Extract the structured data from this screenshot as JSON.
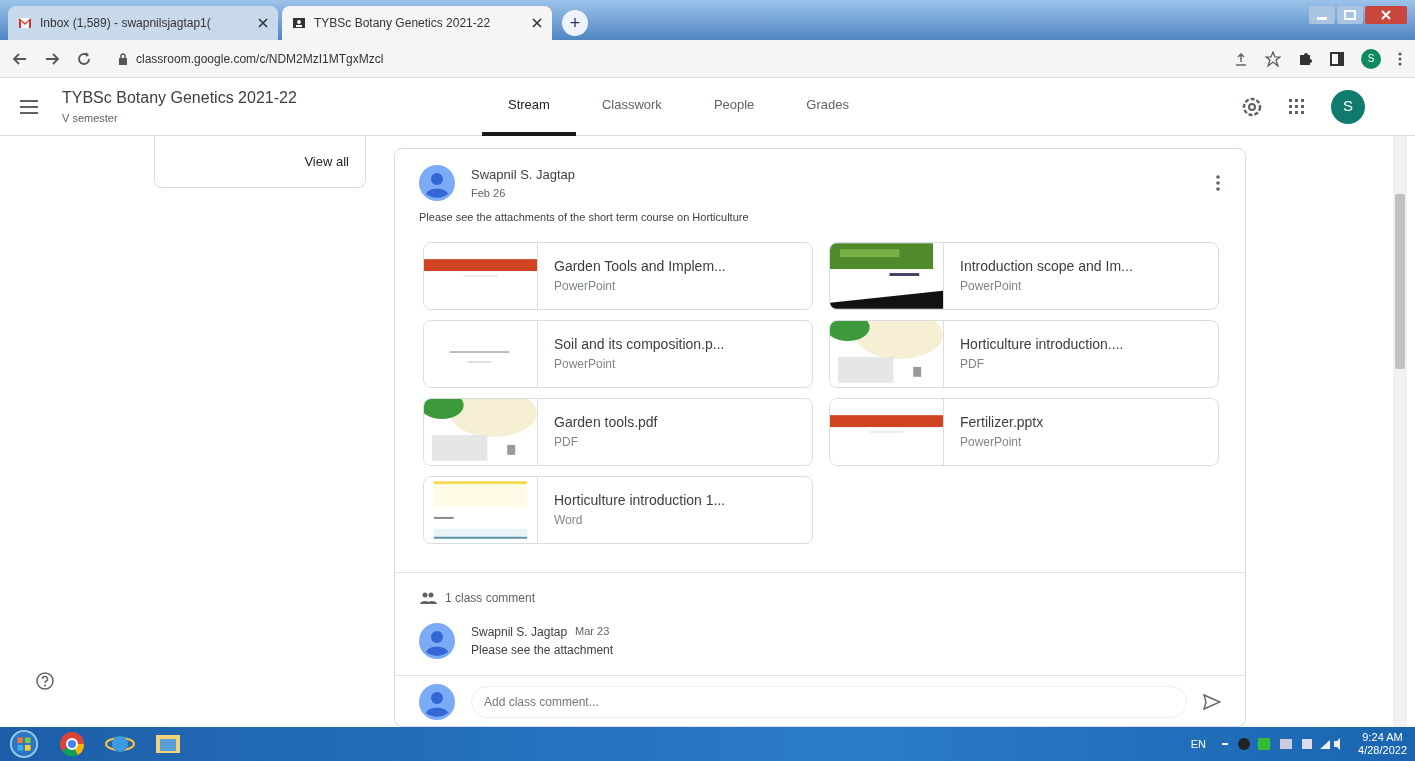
{
  "browser": {
    "tabs": [
      {
        "label": "Inbox (1,589) - swapnilsjagtap1(",
        "selected": false,
        "kind": "mail"
      },
      {
        "label": "TYBSc Botany Genetics 2021-22",
        "selected": true,
        "kind": "classroom"
      }
    ],
    "new_tab": "+",
    "url": "classroom.google.com/c/NDM2MzI1MTgxMzcl",
    "profile": "S"
  },
  "header": {
    "title": "TYBSc Botany Genetics 2021-22",
    "subtitle": "V semester",
    "nav": [
      {
        "label": "Stream",
        "selected": true
      },
      {
        "label": "Classwork",
        "selected": false
      },
      {
        "label": "People",
        "selected": false
      },
      {
        "label": "Grades",
        "selected": false
      }
    ],
    "avatar": "S"
  },
  "sidebar": {
    "link": "View all"
  },
  "post": {
    "author": "Swapnil S. Jagtap",
    "date": "Feb 26",
    "text": "Please see the attachments of the short term course on Horticulture",
    "attachments": [
      {
        "title": "Garden Tools and Implem...",
        "type": "PowerPoint",
        "kind": "banner"
      },
      {
        "title": "Introduction scope and Im...",
        "type": "PowerPoint",
        "kind": "photo"
      },
      {
        "title": "Soil and its composition.p...",
        "type": "PowerPoint",
        "kind": "blank"
      },
      {
        "title": "Horticulture introduction....",
        "type": "PDF",
        "kind": "leaf"
      },
      {
        "title": "Garden tools.pdf",
        "type": "PDF",
        "kind": "leaf"
      },
      {
        "title": "Fertilizer.pptx",
        "type": "PowerPoint",
        "kind": "banner"
      },
      {
        "title": "Horticulture introduction 1...",
        "type": "Word",
        "kind": "doc"
      }
    ],
    "comments_label": "1 class comment",
    "comments": [
      {
        "author": "Swapnil S. Jagtap",
        "date": "Mar 23",
        "text": "Please see the attachment"
      }
    ],
    "comment_placeholder": "Add class comment..."
  },
  "taskbar": {
    "language": "EN",
    "time": "9:24 AM",
    "date": "4/28/2022"
  }
}
